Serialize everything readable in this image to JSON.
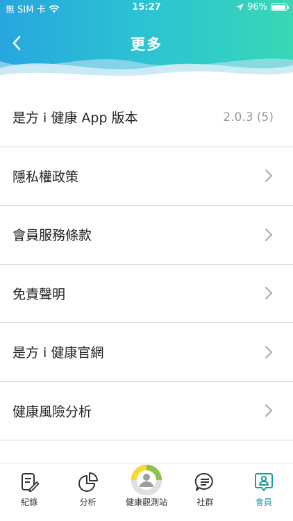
{
  "status_bar": {
    "carrier": "無 SIM 卡",
    "time": "15:27",
    "battery": "96%",
    "battery_level": 0.96
  },
  "header": {
    "title": "更多"
  },
  "menu": {
    "items": [
      {
        "label": "是方 i 健康 App 版本",
        "value": "2.0.3 (5)"
      },
      {
        "label": "隱私權政策"
      },
      {
        "label": "會員服務條款"
      },
      {
        "label": "免責聲明"
      },
      {
        "label": "是方 i 健康官網"
      },
      {
        "label": "健康風險分析"
      }
    ]
  },
  "tabbar": {
    "tabs": [
      {
        "label": "紀錄",
        "icon": "record-icon"
      },
      {
        "label": "分析",
        "icon": "pie-chart-icon"
      },
      {
        "label": "健康觀測站",
        "icon": "health-station-icon"
      },
      {
        "label": "社群",
        "icon": "chat-icon"
      },
      {
        "label": "會員",
        "icon": "member-icon",
        "active": true
      }
    ]
  },
  "colors": {
    "header_start": "#27a6df",
    "header_end": "#38d8b6",
    "active_tab": "#1a9c97",
    "value_text": "#9a9a9a"
  }
}
